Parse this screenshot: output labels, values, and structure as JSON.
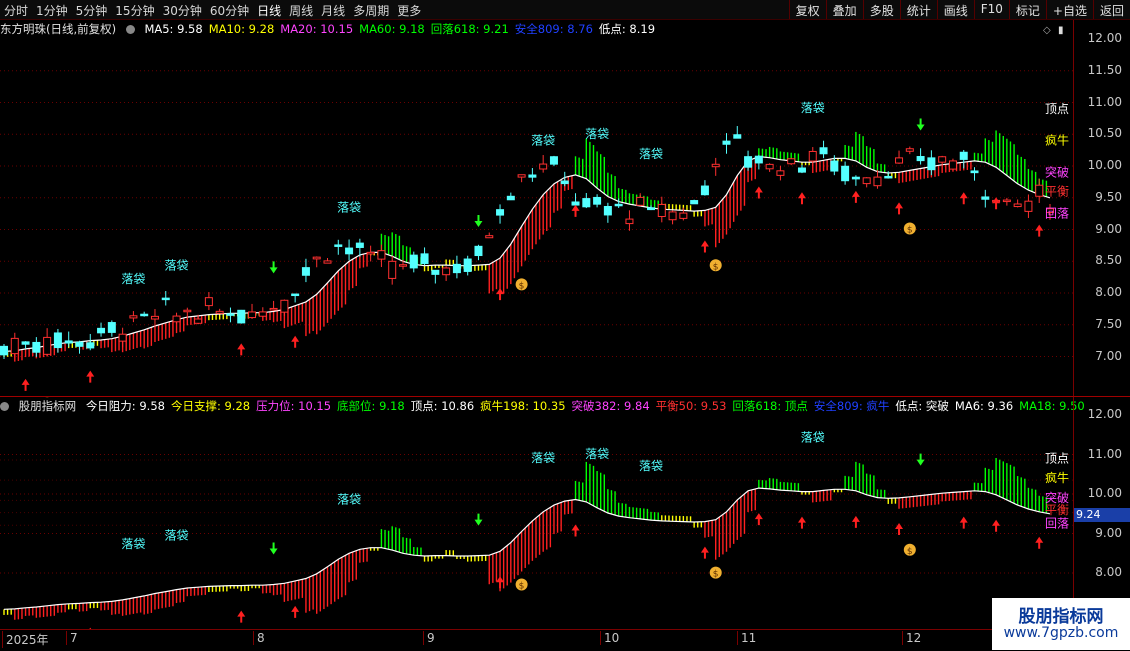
{
  "toolbar": {
    "periods": [
      "分时",
      "1分钟",
      "5分钟",
      "15分钟",
      "30分钟",
      "60分钟",
      "日线",
      "周线",
      "月线",
      "多周期",
      "更多"
    ],
    "active": "日线",
    "buttons": [
      "复权",
      "叠加",
      "多股",
      "统计",
      "画线",
      "F10",
      "标记",
      "+自选",
      "返回"
    ]
  },
  "main_info": {
    "stock": "东方明珠(日线,前复权)",
    "items": [
      {
        "text": "MA5: 9.58",
        "color": "#ffffff"
      },
      {
        "text": "MA10: 9.28",
        "color": "#ffff00"
      },
      {
        "text": "MA20: 10.15",
        "color": "#ff44ff"
      },
      {
        "text": "MA60: 9.18",
        "color": "#00ff00"
      },
      {
        "text": "回落618: 9.21",
        "color": "#00ff00"
      },
      {
        "text": "安全809: 8.76",
        "color": "#2040ff"
      },
      {
        "text": "低点: 8.19",
        "color": "#ffffff"
      }
    ]
  },
  "sub_info": {
    "indicator": "股朋指标网",
    "items": [
      {
        "text": "今日阻力: 9.58",
        "color": "#ffffff"
      },
      {
        "text": "今日支撑: 9.28",
        "color": "#ffff00"
      },
      {
        "text": "压力位: 10.15",
        "color": "#ff44ff"
      },
      {
        "text": "底部位: 9.18",
        "color": "#00ff00"
      },
      {
        "text": "顶点: 10.86",
        "color": "#ffffff"
      },
      {
        "text": "疯牛198: 10.35",
        "color": "#ffff00"
      },
      {
        "text": "突破382: 9.84",
        "color": "#ff44ff"
      },
      {
        "text": "平衡50: 9.53",
        "color": "#ff3030"
      },
      {
        "text": "回落618: 顶点",
        "color": "#00ff00"
      },
      {
        "text": "安全809: 疯牛",
        "color": "#2040ff"
      },
      {
        "text": "低点: 突破",
        "color": "#ffffff"
      },
      {
        "text": "MA6: 9.36",
        "color": "#ffffff"
      },
      {
        "text": "MA18: 9.50",
        "color": "#00ff00"
      }
    ]
  },
  "main_axis": [
    "12.00",
    "11.50",
    "11.00",
    "10.50",
    "10.00",
    "9.50",
    "9.00",
    "8.50",
    "8.00",
    "7.50",
    "7.00"
  ],
  "sub_axis": [
    "12.00",
    "11.00",
    "10.00",
    "9.00",
    "8.00"
  ],
  "level_labels": [
    {
      "text": "顶点",
      "color": "#ffffff"
    },
    {
      "text": "疯牛",
      "color": "#ffff00"
    },
    {
      "text": "突破",
      "color": "#ff44ff"
    },
    {
      "text": "平衡",
      "color": "#ff3030"
    },
    {
      "text": "回落",
      "color": "#ff44ff"
    }
  ],
  "pocket_label": "落袋",
  "price_tag": "9.24",
  "date_axis": [
    "2025年",
    "7",
    "8",
    "9",
    "10",
    "11",
    "12"
  ],
  "watermark": {
    "title": "股朋指标网",
    "url": "www.7gpzb.com"
  },
  "colors": {
    "up": "#ff3030",
    "down": "#54ffff",
    "bull": "#ff2020",
    "flat": "#ffff00",
    "bear": "#00ff00"
  },
  "chart_data": {
    "type": "candlestick",
    "ma_main": [
      7.08,
      7.09,
      7.12,
      7.14,
      7.17,
      7.2,
      7.22,
      7.23,
      7.25,
      7.26,
      7.28,
      7.32,
      7.37,
      7.42,
      7.48,
      7.53,
      7.58,
      7.62,
      7.64,
      7.66,
      7.67,
      7.68,
      7.68,
      7.69,
      7.69,
      7.71,
      7.74,
      7.8,
      7.86,
      7.98,
      8.16,
      8.35,
      8.5,
      8.6,
      8.64,
      8.64,
      8.58,
      8.5,
      8.45,
      8.43,
      8.44,
      8.44,
      8.43,
      8.43,
      8.44,
      8.45,
      8.55,
      8.77,
      9.05,
      9.32,
      9.55,
      9.72,
      9.82,
      9.86,
      9.8,
      9.65,
      9.52,
      9.44,
      9.4,
      9.37,
      9.34,
      9.32,
      9.31,
      9.3,
      9.29,
      9.3,
      9.35,
      9.55,
      9.85,
      10.08,
      10.15,
      10.13,
      10.1,
      10.08,
      10.06,
      10.06,
      10.09,
      10.12,
      10.12,
      10.08,
      9.98,
      9.91,
      9.89,
      9.9,
      9.93,
      9.96,
      9.99,
      10.02,
      10.04,
      10.06,
      10.08,
      10.06,
      9.98,
      9.85,
      9.72,
      9.62,
      9.55,
      9.5
    ]
  }
}
